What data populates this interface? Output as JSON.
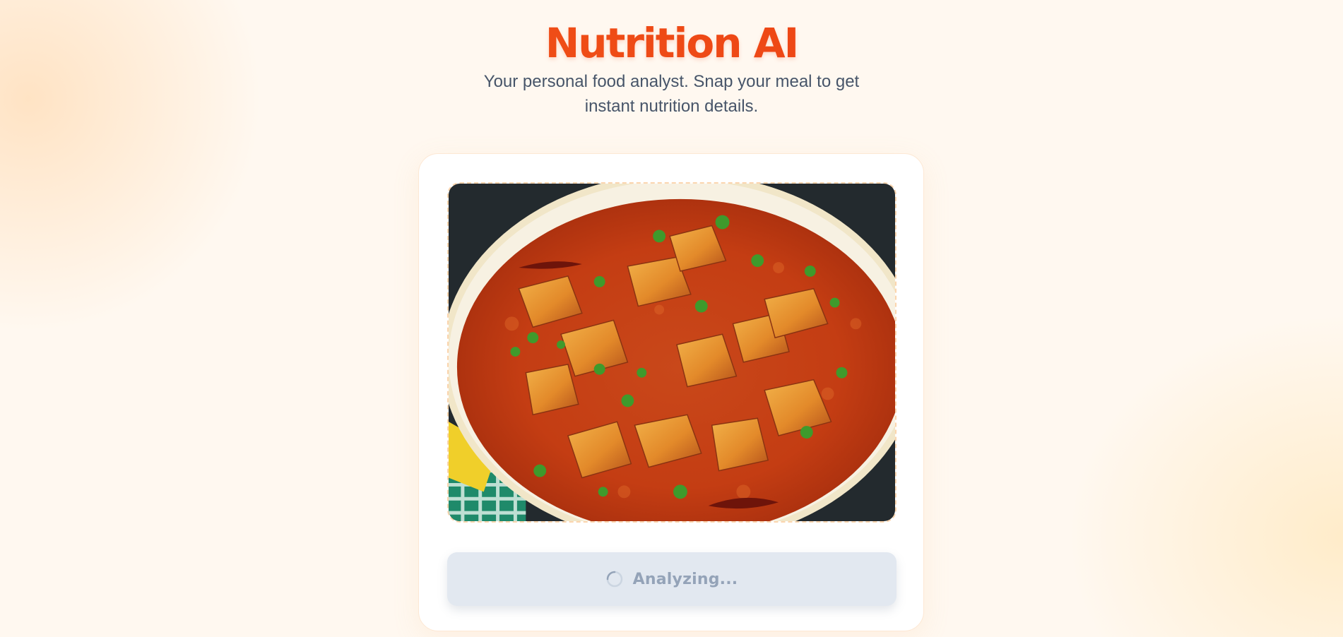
{
  "app": {
    "title": "Nutrition AI",
    "subtitle": "Your personal food analyst. Snap your meal to get instant nutrition details."
  },
  "upload": {
    "image_subject": "paneer curry in a yellow pan"
  },
  "analyze_button": {
    "label": "Analyzing...",
    "state": "loading",
    "icon": "spinner-icon"
  },
  "colors": {
    "accent": "#f1481a",
    "subtitle_text": "#475569",
    "button_bg": "#e2e8f0",
    "button_text": "#94a3b8",
    "dropzone_border": "#fbd5ae"
  }
}
